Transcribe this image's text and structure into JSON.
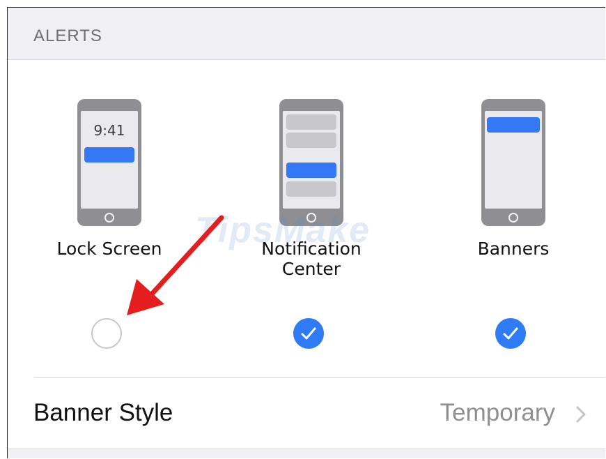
{
  "section": {
    "title": "ALERTS"
  },
  "options": [
    {
      "label": "Lock Screen",
      "preview_time": "9:41",
      "selected": false,
      "icon": "lock-screen-preview-icon"
    },
    {
      "label": "Notification Center",
      "selected": true,
      "icon": "notification-center-preview-icon"
    },
    {
      "label": "Banners",
      "selected": true,
      "icon": "banners-preview-icon"
    }
  ],
  "banner_style": {
    "label": "Banner Style",
    "value": "Temporary"
  },
  "watermark": "TipsMake",
  "colors": {
    "accent": "#2f7bf5",
    "background": "#efeff4",
    "arrow": "#e41e1e"
  }
}
